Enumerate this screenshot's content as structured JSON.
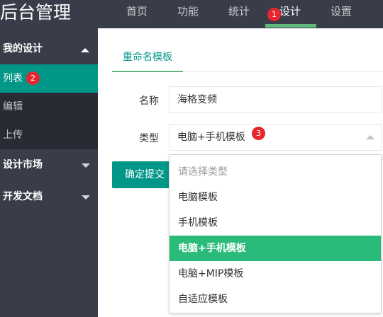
{
  "header": {
    "logo": "后台管理",
    "nav": [
      "首页",
      "功能",
      "统计",
      "设计",
      "设置"
    ],
    "active_nav": "设计"
  },
  "badges": [
    "1",
    "2",
    "3"
  ],
  "sidebar": {
    "groups": [
      {
        "label": "我的设计",
        "expanded": true,
        "items": [
          "列表",
          "编辑",
          "上传"
        ],
        "active_item": "列表"
      },
      {
        "label": "设计市场",
        "expanded": false
      },
      {
        "label": "开发文档",
        "expanded": false
      }
    ]
  },
  "tabs": {
    "active": "重命名模板"
  },
  "form": {
    "name_label": "名称",
    "name_value": "海格变频",
    "type_label": "类型",
    "type_value": "电脑+手机模板",
    "submit_label": "确定提交"
  },
  "dropdown": {
    "placeholder": "请选择类型",
    "options": [
      "电脑模板",
      "手机模板",
      "电脑+手机模板",
      "电脑+MIP模板",
      "自适应模板"
    ],
    "selected": "电脑+手机模板"
  },
  "colors": {
    "header_bg": "#393D49",
    "sidebar_sub_bg": "#282B33",
    "accent_teal": "#009688",
    "accent_green": "#5FB878",
    "selected_option": "#2ABB7A",
    "badge_red": "#E8262E"
  }
}
